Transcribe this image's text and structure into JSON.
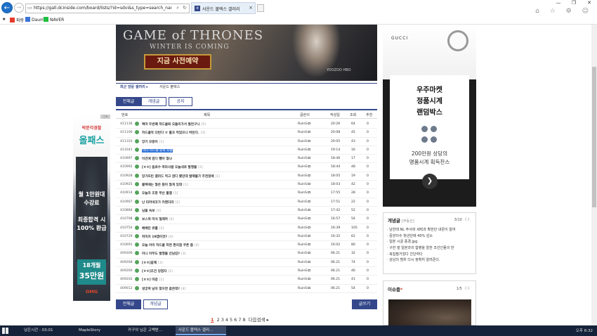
{
  "browser": {
    "url": "https://gall.dcinside.com/board/lists/?id=sdvi&s_type=search_name&s_keyword=Ruin",
    "tab_title": "사운드 볼텍스 갤러리",
    "favorites": [
      "파랑",
      "Daum",
      "NAVER"
    ],
    "window_controls": [
      "—",
      "❐",
      "✕"
    ],
    "top_icons": "⌂ ☆ ⚙ ☺"
  },
  "banner": {
    "title": "GAME of THRONES",
    "subtitle": "WINTER IS COMING",
    "cta": "지금 사전예약",
    "logos": "YOOZOO  HBO"
  },
  "gallery_nav": {
    "recent": "최근 방문 갤러리 ▸",
    "current": "사운드 볼텍스"
  },
  "tabs": [
    "전체글",
    "개념글",
    "공지"
  ],
  "table": {
    "headers": [
      "번호",
      "제목",
      "글쓴이",
      "작성일",
      "조회",
      "추천"
    ],
    "rows": [
      {
        "no": "411136",
        "subject": "택마 두번째 하드클뢰 오들이가서 발연구니",
        "reply": "[5]",
        "writer": "RuinS",
        "date": "20:26",
        "views": "64",
        "rec": "0"
      },
      {
        "no": "411106",
        "subject": "하드클작 더런다 ㅠ 볼꼬 먹었으니 버린다.",
        "reply": "[3]",
        "writer": "RuinS",
        "date": "20:08",
        "views": "45",
        "rec": "0"
      },
      {
        "no": "411103",
        "subject": "앙기 오랑이",
        "reply": "[1]",
        "writer": "RuinS",
        "date": "20:05",
        "views": "43",
        "rec": "0"
      },
      {
        "no": "411041",
        "subject": "미니 하드클 블랙 후클",
        "reply": "",
        "writer": "RuinS",
        "date": "19:14",
        "views": "16",
        "rec": "0",
        "highlight": true
      },
      {
        "no": "410997",
        "subject": "이건에 검디 뺐어 많냐",
        "reply": "",
        "writer": "RuinS",
        "date": "18:46",
        "views": "17",
        "rec": "0"
      },
      {
        "no": "410992",
        "subject": "[ㅎㅎ] 음료수 따라사람 오늘내로 발행물",
        "reply": "[2]",
        "writer": "RuinS",
        "date": "18:44",
        "views": "48",
        "rec": "0"
      },
      {
        "no": "410928",
        "subject": "망가뜨린 갤러드 먹고 검디 됐던데 발매물가 추천정애",
        "reply": "[1]",
        "writer": "RuinS",
        "date": "18:05",
        "views": "19",
        "rec": "0"
      },
      {
        "no": "410925",
        "subject": "볼텍에는 많은 뭔이 많게 있데",
        "reply": "[1]",
        "writer": "RuinS",
        "date": "18:03",
        "views": "42",
        "rec": "0"
      },
      {
        "no": "410914",
        "subject": "오늘자 조항 부산 볼갤",
        "reply": "[1]",
        "writer": "RuinS",
        "date": "17:55",
        "views": "28",
        "rec": "0"
      },
      {
        "no": "410907",
        "subject": "난 타마네코가 커멘더라",
        "reply": "[2]",
        "writer": "RuinS",
        "date": "17:51",
        "views": "22",
        "rec": "0"
      },
      {
        "no": "410884",
        "subject": "님들 속보",
        "reply": "[4]",
        "writer": "RuinS",
        "date": "17:42",
        "views": "52",
        "rec": "0"
      },
      {
        "no": "410798",
        "subject": "보스픽 미식 밀레마",
        "reply": "[4]",
        "writer": "RuinS",
        "date": "16:57",
        "views": "54",
        "rec": "0"
      },
      {
        "no": "410754",
        "subject": "베베린 큐롤",
        "reply": "[3]",
        "writer": "RuinS",
        "date": "16:39",
        "views": "105",
        "rec": "0"
      },
      {
        "no": "410729",
        "subject": "뒤미프 19앱이것?",
        "reply": "[4]",
        "writer": "RuinS",
        "date": "16:32",
        "views": "62",
        "rec": "0"
      },
      {
        "no": "410691",
        "subject": "오늘 아이 하드클 하면 편의점 쿠폰 줌",
        "reply": "[4]",
        "writer": "RuinS",
        "date": "16:02",
        "views": "80",
        "rec": "0"
      },
      {
        "no": "409306",
        "subject": "미니 아무도 발행물 안남김?",
        "reply": "[3]",
        "writer": "RuinS",
        "date": "06.21",
        "views": "32",
        "rec": "0"
      },
      {
        "no": "409268",
        "subject": "[ㅎㅎ]같제",
        "reply": "[3]",
        "writer": "RuinS",
        "date": "06.21",
        "views": "74",
        "rec": "0"
      },
      {
        "no": "409260",
        "subject": "[ㅎㅎ]조건 당첨자",
        "reply": "[2]",
        "writer": "RuinS",
        "date": "06.21",
        "views": "46",
        "rec": "0"
      },
      {
        "no": "409202",
        "subject": "[ㅎㅎ] 마감",
        "reply": "[1]",
        "writer": "RuinS",
        "date": "06.21",
        "views": "41",
        "rec": "0"
      },
      {
        "no": "409012",
        "subject": "냉궁퀴 남자 맞으면 같은데?",
        "reply": "[4]",
        "writer": "RuinS",
        "date": "06.21",
        "views": "54",
        "rec": "0"
      }
    ]
  },
  "bottom_buttons": {
    "all": "전체글",
    "concept": "개념글",
    "write": "글쓰기"
  },
  "pagination": {
    "current": "1",
    "pages": [
      "2",
      "3",
      "4",
      "5",
      "6",
      "7",
      "8"
    ],
    "next": "다음검색 ▸"
  },
  "left_ad": {
    "line1": "박문각경찰",
    "line2": "올패스",
    "line3": "월 1만원대",
    "line4": "수강료",
    "line5": "최종합격 시",
    "line6": "100% 환급",
    "box1": "18개월",
    "box2": "35만원",
    "brand": "OMG",
    "close": "ⓘ✕"
  },
  "right_ad": {
    "brand": "GUCCI",
    "line1": "우주마켓",
    "line2": "정품시계",
    "line3": "랜덤박스",
    "line4": "200만원 상당의",
    "line5": "명품시계 획득찬스",
    "arrow": "❯"
  },
  "concept_box": {
    "title": "개념글",
    "sub": "[부동산]",
    "page": "3/10 〈 〉",
    "items": [
      "· 남한데 NL 주사파 세력과 확한안 내몬이 알여",
      "· 중앙이수 첫년단에 40% 감소",
      "· 일본 시골 풍경.jpg",
      "· 구한 말 일본과의 합병을 알한 조선인들의 반",
      "· 북집필거었다 간단하다",
      "· 강남의 범위 다시 정확히 알려준다."
    ]
  },
  "issue_box": {
    "title": "이슈줌",
    "star": "*",
    "page": "1/5 〈 〉"
  },
  "taskbar": {
    "items": [
      "남은시간 : 03:01",
      "MapleStory",
      "카구야 님은 고백받...",
      "사운드 볼텍스 갤러..."
    ],
    "clock": "오후 8:32"
  }
}
